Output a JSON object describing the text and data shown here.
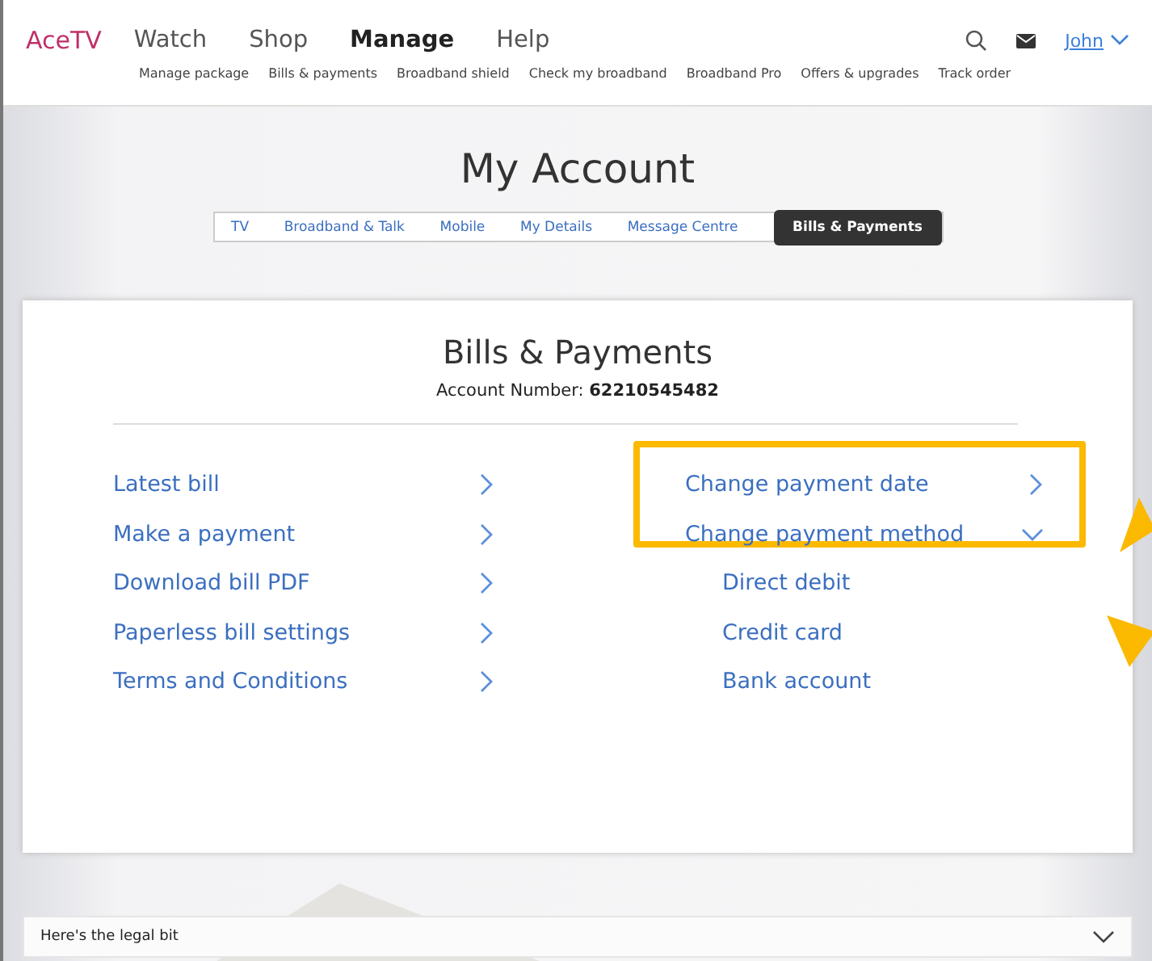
{
  "brand": "AceTV",
  "main_nav": [
    {
      "label": "Watch",
      "selected": false
    },
    {
      "label": "Shop",
      "selected": false
    },
    {
      "label": "Manage",
      "selected": true
    },
    {
      "label": "Help",
      "selected": false
    }
  ],
  "user": "John",
  "sub_nav": [
    "Manage package",
    "Bills & payments",
    "Broadband shield",
    "Check my broadband",
    "Broadband Pro",
    "Offers & upgrades",
    "Track order"
  ],
  "page_title": "My Account",
  "tabs": [
    {
      "label": "TV",
      "selected": false
    },
    {
      "label": "Broadband & Talk",
      "selected": false
    },
    {
      "label": "Mobile",
      "selected": false
    },
    {
      "label": "My Details",
      "selected": false
    },
    {
      "label": "Message Centre",
      "selected": false
    },
    {
      "label": "Bills & Payments",
      "selected": true
    }
  ],
  "card": {
    "title": "Bills & Payments",
    "account_label": "Account Number:",
    "account_number": "62210545482",
    "left_links": [
      "Latest bill",
      "Make a payment",
      "Download bill PDF",
      "Paperless bill settings",
      "Terms and Conditions"
    ],
    "highlight_frame": true,
    "right_links": [
      {
        "label": "Change payment date",
        "expanded": false
      },
      {
        "label": "Change payment method",
        "expanded": true,
        "children": [
          "Direct debit",
          "Credit card",
          "Bank account"
        ]
      }
    ]
  },
  "legal": {
    "label": "Here's the legal bit",
    "expanded": false
  }
}
